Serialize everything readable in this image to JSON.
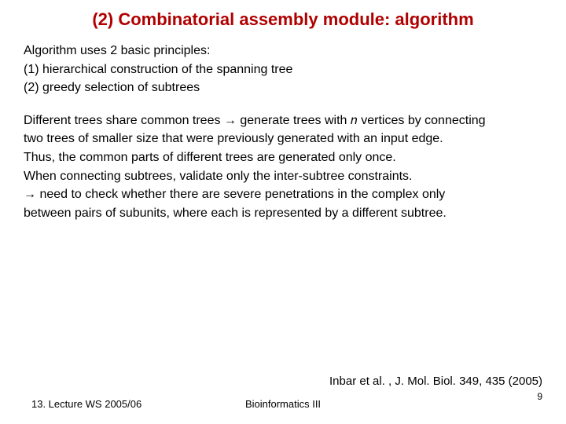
{
  "title": "(2) Combinatorial assembly module: algorithm",
  "intro": {
    "l1": "Algorithm uses 2 basic principles:",
    "l2": "(1) hierarchical construction of the spanning tree",
    "l3": "(2) greedy selection of subtrees"
  },
  "para": {
    "l1a": "Different trees share common trees → generate trees with ",
    "l1_n": "n",
    "l1b": " vertices by connecting",
    "l2": "two trees of smaller size that were previously generated with an input edge.",
    "l3": "Thus, the common parts of different trees are generated only once.",
    "l4": "When connecting subtrees, validate only the inter-subtree constraints.",
    "l5": "→ need to check whether there are severe penetrations in the complex only",
    "l6": "between pairs of subunits, where each is represented by a different subtree."
  },
  "citation": "Inbar et al. , J. Mol. Biol. 349, 435 (2005)",
  "pagenum": "9",
  "footer_left": "13. Lecture WS 2005/06",
  "footer_center": "Bioinformatics III"
}
